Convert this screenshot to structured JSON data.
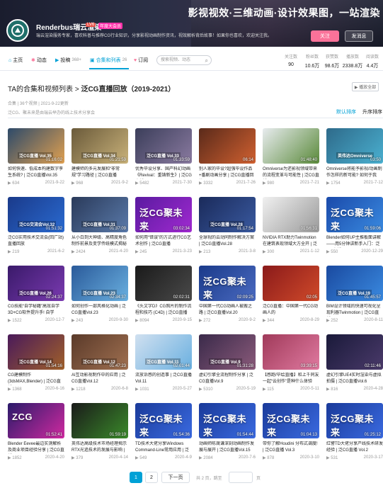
{
  "banner": {
    "slogan": "影视视效·三维动画·设计效果图，一站渲染",
    "username": "Renderbus瑞云渲染",
    "level": "LV6",
    "vip": "年度大会员",
    "bio": "瑞云渲染服务专家，喜欢科普与推荐CG行业知识，分享影视动画制作资讯，视效解析背后故事！如果你也喜欢，欢迎关注我。",
    "follow": "关注",
    "message": "发消息"
  },
  "nav": {
    "items": [
      {
        "label": "主页",
        "count": ""
      },
      {
        "label": "动态",
        "count": ""
      },
      {
        "label": "投稿",
        "count": "368+"
      },
      {
        "label": "合集和列表",
        "count": "26"
      },
      {
        "label": "订阅",
        "count": ""
      }
    ],
    "search_placeholder": "搜索视频、动态",
    "stats": [
      {
        "label": "关注数",
        "value": "90"
      },
      {
        "label": "粉丝数",
        "value": "10.6万"
      },
      {
        "label": "获赞数",
        "value": "98.6万"
      },
      {
        "label": "播放数",
        "value": "2338.8万"
      },
      {
        "label": "阅读数",
        "value": "4.4万"
      }
    ]
  },
  "section": {
    "breadcrumb": "TA的合集和视频列表",
    "sep": " > ",
    "title": "泛CG直播回放（2019-2021）",
    "play_all": "▶ 播放全部",
    "meta": "合集 | 36个视频 | 2021-9-22更新",
    "desc": "泛CG、聚未来是由瑞云举办的线上技术分享会",
    "sort_default": "默认排序",
    "sort_up": "升序排序"
  },
  "videos": [
    {
      "title": "如何快速、低成本构建数字孪生系统? | 泛CG直播Vol.35",
      "plays": "634",
      "date": "2021-9-22",
      "duration": "01:16:02",
      "thumb": "#2d4a6a",
      "thumb2": "#e0a050",
      "label": "泛CG直播 Vol.35"
    },
    {
      "title": "建模师的多元发展和“非常规”学习路径 | 泛CG直播",
      "plays": "968",
      "date": "2021-9-2",
      "duration": "01:21:59",
      "thumb": "#6a5a3a",
      "thumb2": "#c9b27a",
      "label": "泛CG直播 Vol.34"
    },
    {
      "title": "优秀毕设分享、国产科幻动画《Revival：重铸新生》| 泛CG直播",
      "plays": "5482",
      "date": "2021-7-30",
      "duration": "01:33:59",
      "thumb": "#3b3e5a",
      "thumb2": "#8a7aa0",
      "label": "泛CG直播 Vol.33"
    },
    {
      "title": "别人家的毕设?超强毕设作品+番剧动画分享 | 泛CG直播回放",
      "plays": "3332",
      "date": "2021-7-26",
      "duration": "06:14",
      "thumb": "#5a2a1a",
      "thumb2": "#d06030",
      "label": ""
    },
    {
      "title": "Omniverse为还影视领域带来的流程变革与可能性 | 泛CG直播",
      "plays": "980",
      "date": "2021-7-21",
      "duration": "01:48:40",
      "thumb": "#e8ecef",
      "thumb2": "#5a8a3a",
      "label": ""
    },
    {
      "title": "Omniverse将能予影视/动画制作怎样的新可能? 如何于我",
      "plays": "1754",
      "date": "2021-7-12",
      "duration": "03:50",
      "thumb": "#2e6a8a",
      "thumb2": "#4ab0d0",
      "label": "英伟达Omniverse"
    },
    {
      "title": "泛CG实用技术交流会(回广站)直播回放",
      "plays": "219",
      "date": "2021-6-2",
      "duration": "01:51:32",
      "thumb": "#1a3a8a",
      "thumb2": "#2a6ad0",
      "label": "泛CG交流会Vol.32"
    },
    {
      "title": "从小白到大神级、高精度角色制作前景及变学传统模式揭秘",
      "plays": "2424",
      "date": "2021-4-20",
      "duration": "01:37:09",
      "thumb": "#2a3a5a",
      "thumb2": "#5a7aaa",
      "label": "泛CG直播 Vol.31"
    },
    {
      "title": "如何用“错误”的方式进行CG艺术创作 | 泛CG直播",
      "plays": "245",
      "date": "2021-3-23",
      "duration": "03:02:34",
      "thumb": "#5a1aa0",
      "thumb2": "#a02ad0",
      "label": "泛CG聚未来"
    },
    {
      "title": "全球视的云动同制作解决方案 | 泛CG直播Vol.28",
      "plays": "213",
      "date": "2021-3-8",
      "duration": "01:17:54",
      "thumb": "#1a2a5a",
      "thumb2": "#3a5aa0",
      "label": "泛CG直播 Vol.28"
    },
    {
      "title": "NVIDIA RTX助力Twinmotion在建筑表现领域大方全开 | 泛",
      "plays": "300",
      "date": "2021-1-12",
      "duration": "01:56:31",
      "thumb": "#f0f0f0",
      "thumb2": "#9a9a9a",
      "label": ""
    },
    {
      "title": "Blender如何UP主推板面讲解——用5分钟讲新手入门：泛CG直播",
      "plays": "550",
      "date": "2020-12-29",
      "duration": "01:59:06",
      "thumb": "#1a4aaa",
      "thumb2": "#3a8ae0",
      "label": "泛CG聚未来"
    },
    {
      "title": "CG技能“自学秘籍”高效自学3D+CG软件提升手! 自学",
      "plays": "1522",
      "date": "2020-12-7",
      "duration": "02:24:37",
      "thumb": "#3a1a6a",
      "thumb2": "#7a3ab0",
      "label": "泛CG直播 Vol.26"
    },
    {
      "title": "如何创作一部风格化动画 | 泛CG直播Vol.23",
      "plays": "243",
      "date": "2020-9-30",
      "duration": "02:34:37",
      "thumb": "#2a5a9a",
      "thumb2": "#6ab0e0",
      "label": "泛CG直播 Vol.23"
    },
    {
      "title": "《头文字D》CG照片的制作流程和技巧 (C4D) | 泛CG直播",
      "plays": "8094",
      "date": "2020-9-15",
      "duration": "02:02:31",
      "thumb": "#1a1a1a",
      "thumb2": "#4a4a4a",
      "label": ""
    },
    {
      "title": "中国第一代CG动画人被搬之路 | 泛CG直播Vol.20",
      "plays": "272",
      "date": "2020-9-2",
      "duration": "02:09:25",
      "thumb": "#1a3a8a",
      "thumb2": "#4a6ac0",
      "label": "泛CG聚未来"
    },
    {
      "title": "泛CG直播：中国第一代CG动画人的",
      "plays": "344",
      "date": "2020-8-29",
      "duration": "02:05",
      "thumb": "#8a1a1a",
      "thumb2": "#d04a2a",
      "label": ""
    },
    {
      "title": "BIM设计领域的快速可视化呈现利器Twinmotion | 泛CG直播",
      "plays": "252",
      "date": "2020-8-11",
      "duration": "01:45:57",
      "thumb": "#1a4aa0",
      "thumb2": "#3a8ae0",
      "label": "泛CG直播 Vol.19"
    },
    {
      "title": "CG建模制作(3dsMAX,Blender) | 泛CG直播",
      "plays": "1368",
      "date": "2020-6-16",
      "duration": "01:54:16",
      "thumb": "#4a1a5a",
      "thumb2": "#a0602a",
      "label": "泛CG直播 Vol.14"
    },
    {
      "title": "AI互动影视制作中的应用 | 泛CG直播Vol.12",
      "plays": "1218",
      "date": "2020-6-8",
      "duration": "01:47:23",
      "thumb": "#5a3a2a",
      "thumb2": "#a07050",
      "label": "泛CG直播 Vol.12"
    },
    {
      "title": "流放诉感的创造事 | 泛CG直播Vol.11",
      "plays": "1031",
      "date": "2020-5-27",
      "duration": "02:01:44",
      "thumb": "#d0e0f0",
      "thumb2": "#6ab0e0",
      "label": "泛CG直播 Vol.11"
    },
    {
      "title": "虚幻引擎全流程制作分享 | 泛CG直播Vol.9",
      "plays": "5310",
      "date": "2020-5-19",
      "duration": "01:31:28",
      "thumb": "#3a2a4a",
      "thumb2": "#8a5a7a",
      "label": "泛CG直播 Vol.9"
    },
    {
      "title": "【感跑/毕绘直播】和上千同友一起“云创作”是种什么体验",
      "plays": "115",
      "date": "2020-5-11",
      "duration": "03:39:15",
      "thumb": "#a03a5a",
      "thumb2": "#e07aa0",
      "label": ""
    },
    {
      "title": "虚幻引擎UE4实时渲染与虚拟拍摄 | 泛CG直播Vol.6",
      "plays": "816",
      "date": "2020-4-28",
      "duration": "02:11:46",
      "thumb": "#1a1a3a",
      "thumb2": "#4a3a6a",
      "label": ""
    },
    {
      "title": "Blender Eevee最边实测解析及商业项目经验分享 | 泛CG直播",
      "plays": "1852",
      "date": "2020-4-20",
      "duration": "01:52:41",
      "thumb": "#2a1a6a",
      "thumb2": "#d02aa0",
      "label": "ZCG"
    },
    {
      "title": "英伟达高级技术市场经理揭示RTX光追技术的发展与影响 |",
      "plays": "379",
      "date": "2020-4-14",
      "duration": "01:59:19",
      "thumb": "#1a1a1a",
      "thumb2": "#3a8a2a",
      "label": ""
    },
    {
      "title": "TD技术大佬分享Windows Command-Line常用应用 | 泛",
      "plays": "549",
      "date": "2020-4-9",
      "duration": "01:54:36",
      "thumb": "#1a3a9a",
      "thumb2": "#3a6ae0",
      "label": "泛CG聚未来"
    },
    {
      "title": "动画师陈晟谦深刻动画制作发展与展开 | 泛CG直播Vol.15",
      "plays": "2084",
      "date": "2020-7-6",
      "duration": "01:54:44",
      "thumb": "#1a3a9a",
      "thumb2": "#3a6ae0",
      "label": "泛CG聚未来"
    },
    {
      "title": "带你了解Houdini 分布式调度! | 泛CG直播 Vol.3",
      "plays": "878",
      "date": "2020-3-10",
      "duration": "01:04:13",
      "thumb": "#1a3a9a",
      "thumb2": "#3a6ae0",
      "label": "泛CG聚未来"
    },
    {
      "title": "红警TD大佬分享产线技术研发经验 | 泛CG直播 Vol.2",
      "plays": "531",
      "date": "2020-3-17",
      "duration": "01:25:12",
      "thumb": "#1a3a9a",
      "thumb2": "#3a6ae0",
      "label": "泛CG聚未来"
    }
  ],
  "pagination": {
    "pages": [
      "1",
      "2"
    ],
    "next": "下一页",
    "total": "共 2 页，跳至",
    "ye": "页"
  }
}
